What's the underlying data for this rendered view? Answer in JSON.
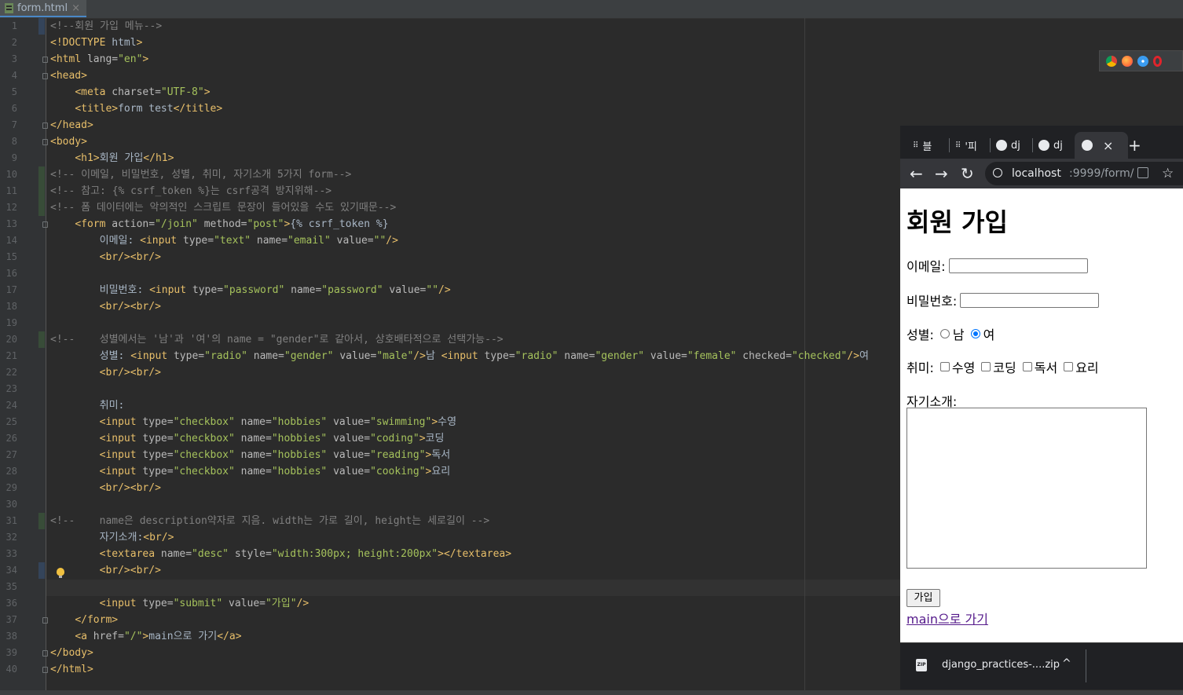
{
  "editor": {
    "tab_name": "form.html",
    "tab_close": "×",
    "lines": [
      "1",
      "2",
      "3",
      "4",
      "5",
      "6",
      "7",
      "8",
      "9",
      "10",
      "11",
      "12",
      "13",
      "14",
      "15",
      "16",
      "17",
      "18",
      "19",
      "20",
      "21",
      "22",
      "23",
      "24",
      "25",
      "26",
      "27",
      "28",
      "29",
      "30",
      "31",
      "32",
      "33",
      "34",
      "35",
      "36",
      "37",
      "38",
      "39",
      "40"
    ],
    "code": [
      [
        [
          "c",
          "<!--회원 가입 메뉴-->"
        ]
      ],
      [
        [
          "t",
          "<!DOCTYPE "
        ],
        [
          "x",
          "html"
        ],
        [
          "t",
          ">"
        ]
      ],
      [
        [
          "t",
          "<html "
        ],
        [
          "a",
          "lang="
        ],
        [
          "s",
          "\"en\""
        ],
        [
          "t",
          ">"
        ]
      ],
      [
        [
          "t",
          "<head>"
        ]
      ],
      [
        [
          "x",
          "    "
        ],
        [
          "t",
          "<meta "
        ],
        [
          "a",
          "charset="
        ],
        [
          "s",
          "\"UTF-8\""
        ],
        [
          "t",
          ">"
        ]
      ],
      [
        [
          "x",
          "    "
        ],
        [
          "t",
          "<title>"
        ],
        [
          "x",
          "form test"
        ],
        [
          "t",
          "</title>"
        ]
      ],
      [
        [
          "t",
          "</head>"
        ]
      ],
      [
        [
          "t",
          "<body>"
        ]
      ],
      [
        [
          "x",
          "    "
        ],
        [
          "t",
          "<h1>"
        ],
        [
          "x",
          "회원 가입"
        ],
        [
          "t",
          "</h1>"
        ]
      ],
      [
        [
          "c",
          "<!-- 이메일, 비밀번호, 성별, 취미, 자기소개 5가지 form-->"
        ]
      ],
      [
        [
          "c",
          "<!-- 참고: {% csrf_token %}는 csrf공격 방지위해-->"
        ]
      ],
      [
        [
          "c",
          "<!-- 폼 데이터에는 악의적인 스크립트 문장이 들어있을 수도 있기때문-->"
        ]
      ],
      [
        [
          "x",
          "    "
        ],
        [
          "t",
          "<form "
        ],
        [
          "a",
          "action="
        ],
        [
          "s",
          "\"/join\""
        ],
        [
          "a",
          " method="
        ],
        [
          "s",
          "\"post\""
        ],
        [
          "t",
          ">"
        ],
        [
          "x",
          "{% csrf_token %}"
        ]
      ],
      [
        [
          "x",
          "        이메일: "
        ],
        [
          "t",
          "<input "
        ],
        [
          "a",
          "type="
        ],
        [
          "s",
          "\"text\""
        ],
        [
          "a",
          " name="
        ],
        [
          "s",
          "\"email\""
        ],
        [
          "a",
          " value="
        ],
        [
          "s",
          "\"\""
        ],
        [
          "t",
          "/>"
        ]
      ],
      [
        [
          "x",
          "        "
        ],
        [
          "t",
          "<br/><br/>"
        ]
      ],
      [
        [
          "x",
          ""
        ]
      ],
      [
        [
          "x",
          "        비밀번호: "
        ],
        [
          "t",
          "<input "
        ],
        [
          "a",
          "type="
        ],
        [
          "s",
          "\"password\""
        ],
        [
          "a",
          " name="
        ],
        [
          "s",
          "\"password\""
        ],
        [
          "a",
          " value="
        ],
        [
          "s",
          "\"\""
        ],
        [
          "t",
          "/>"
        ]
      ],
      [
        [
          "x",
          "        "
        ],
        [
          "t",
          "<br/><br/>"
        ]
      ],
      [
        [
          "x",
          ""
        ]
      ],
      [
        [
          "c",
          "<!--    성별에서는 '남'과 '여'의 name = \"gender\"로 같아서, 상호배타적으로 선택가능-->"
        ]
      ],
      [
        [
          "x",
          "        성별: "
        ],
        [
          "t",
          "<input "
        ],
        [
          "a",
          "type="
        ],
        [
          "s",
          "\"radio\""
        ],
        [
          "a",
          " name="
        ],
        [
          "s",
          "\"gender\""
        ],
        [
          "a",
          " value="
        ],
        [
          "s",
          "\"male\""
        ],
        [
          "t",
          "/>"
        ],
        [
          "x",
          "남 "
        ],
        [
          "t",
          "<input "
        ],
        [
          "a",
          "type="
        ],
        [
          "s",
          "\"radio\""
        ],
        [
          "a",
          " name="
        ],
        [
          "s",
          "\"gender\""
        ],
        [
          "a",
          " value="
        ],
        [
          "s",
          "\"female\""
        ],
        [
          "a",
          " checked="
        ],
        [
          "s",
          "\"checked\""
        ],
        [
          "t",
          "/>"
        ],
        [
          "x",
          "여"
        ]
      ],
      [
        [
          "x",
          "        "
        ],
        [
          "t",
          "<br/><br/>"
        ]
      ],
      [
        [
          "x",
          ""
        ]
      ],
      [
        [
          "x",
          "        취미:"
        ]
      ],
      [
        [
          "x",
          "        "
        ],
        [
          "t",
          "<input "
        ],
        [
          "a",
          "type="
        ],
        [
          "s",
          "\"checkbox\""
        ],
        [
          "a",
          " name="
        ],
        [
          "s",
          "\"hobbies\""
        ],
        [
          "a",
          " value="
        ],
        [
          "s",
          "\"swimming\""
        ],
        [
          "t",
          ">"
        ],
        [
          "x",
          "수영"
        ]
      ],
      [
        [
          "x",
          "        "
        ],
        [
          "t",
          "<input "
        ],
        [
          "a",
          "type="
        ],
        [
          "s",
          "\"checkbox\""
        ],
        [
          "a",
          " name="
        ],
        [
          "s",
          "\"hobbies\""
        ],
        [
          "a",
          " value="
        ],
        [
          "s",
          "\"coding\""
        ],
        [
          "t",
          ">"
        ],
        [
          "x",
          "코딩"
        ]
      ],
      [
        [
          "x",
          "        "
        ],
        [
          "t",
          "<input "
        ],
        [
          "a",
          "type="
        ],
        [
          "s",
          "\"checkbox\""
        ],
        [
          "a",
          " name="
        ],
        [
          "s",
          "\"hobbies\""
        ],
        [
          "a",
          " value="
        ],
        [
          "s",
          "\"reading\""
        ],
        [
          "t",
          ">"
        ],
        [
          "x",
          "독서"
        ]
      ],
      [
        [
          "x",
          "        "
        ],
        [
          "t",
          "<input "
        ],
        [
          "a",
          "type="
        ],
        [
          "s",
          "\"checkbox\""
        ],
        [
          "a",
          " name="
        ],
        [
          "s",
          "\"hobbies\""
        ],
        [
          "a",
          " value="
        ],
        [
          "s",
          "\"cooking\""
        ],
        [
          "t",
          ">"
        ],
        [
          "x",
          "요리"
        ]
      ],
      [
        [
          "x",
          "        "
        ],
        [
          "t",
          "<br/><br/>"
        ]
      ],
      [
        [
          "x",
          ""
        ]
      ],
      [
        [
          "c",
          "<!--    name은 description약자로 지음. width는 가로 길이, height는 세로길이 -->"
        ]
      ],
      [
        [
          "x",
          "        자기소개:"
        ],
        [
          "t",
          "<br/>"
        ]
      ],
      [
        [
          "x",
          "        "
        ],
        [
          "t",
          "<textarea "
        ],
        [
          "a",
          "name="
        ],
        [
          "s",
          "\"desc\""
        ],
        [
          "a",
          " style="
        ],
        [
          "s",
          "\"width:300px; height:200px\""
        ],
        [
          "t",
          "></textarea>"
        ]
      ],
      [
        [
          "x",
          "        "
        ],
        [
          "t",
          "<br/><br/>"
        ]
      ],
      [
        [
          "x",
          ""
        ]
      ],
      [
        [
          "x",
          "        "
        ],
        [
          "t",
          "<input "
        ],
        [
          "a",
          "type="
        ],
        [
          "s",
          "\"submit\""
        ],
        [
          "a",
          " value="
        ],
        [
          "s",
          "\"가입\""
        ],
        [
          "t",
          "/>"
        ]
      ],
      [
        [
          "x",
          "    "
        ],
        [
          "t",
          "</form>"
        ]
      ],
      [
        [
          "x",
          "    "
        ],
        [
          "t",
          "<a "
        ],
        [
          "a",
          "href="
        ],
        [
          "s",
          "\"/\""
        ],
        [
          "t",
          ">"
        ],
        [
          "x",
          "main으로 가기"
        ],
        [
          "t",
          "</a>"
        ]
      ],
      [
        [
          "t",
          "</body>"
        ]
      ],
      [
        [
          "t",
          "</html>"
        ]
      ]
    ]
  },
  "browser": {
    "tabs": [
      "블",
      "'피",
      "dj",
      "dj"
    ],
    "active_tab_close": "×",
    "new_tab": "+",
    "url_host": "localhost",
    "url_rest": ":9999/form/",
    "back": "←",
    "forward": "→",
    "reload": "↻",
    "star": "☆",
    "page": {
      "title": "회원 가입",
      "email_label": "이메일:",
      "password_label": "비밀번호:",
      "gender_label": "성별:",
      "male": "남",
      "female": "여",
      "hobby_label": "취미:",
      "hobbies": [
        "수영",
        "코딩",
        "독서",
        "요리"
      ],
      "intro_label": "자기소개:",
      "submit": "가입",
      "link": "main으로 가기"
    },
    "download": {
      "icon_text": "ZIP",
      "name": "django_practices-....zip",
      "chevron": "^"
    }
  },
  "colors": {
    "tag": "#e8bf6a",
    "string": "#a5c25c",
    "comment": "#808080",
    "text": "#a9b7c6"
  }
}
